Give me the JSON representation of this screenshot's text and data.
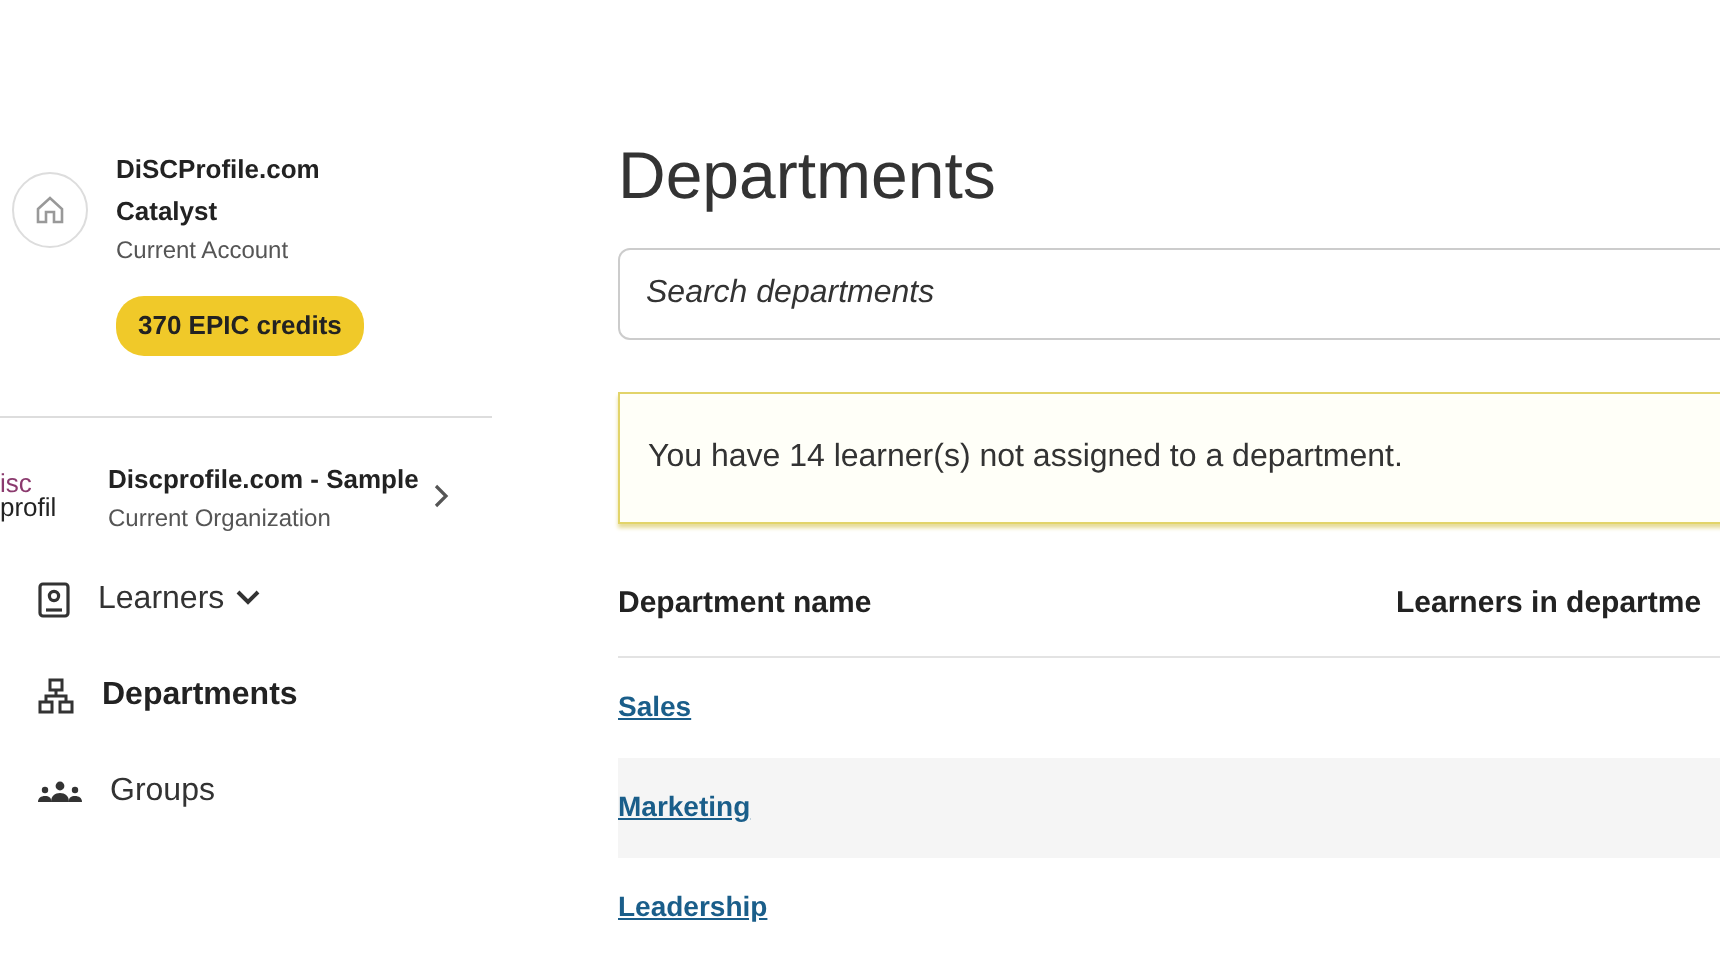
{
  "account": {
    "name": "DiSCProfile.com",
    "plan": "Catalyst",
    "caption": "Current Account",
    "credits": "370 EPIC credits"
  },
  "organization": {
    "logo_lines": [
      "isc",
      "profil"
    ],
    "name": "Discprofile.com - Sample",
    "caption": "Current Organization"
  },
  "nav": [
    {
      "kind": "learners",
      "label": "Learners",
      "selected": false,
      "has_submenu": true
    },
    {
      "kind": "departments",
      "label": "Departments",
      "selected": true,
      "has_submenu": false
    },
    {
      "kind": "groups",
      "label": "Groups",
      "selected": false,
      "has_submenu": false
    }
  ],
  "page_title": "Departments",
  "search": {
    "placeholder": "Search departments"
  },
  "notice": "You have 14 learner(s) not assigned to a department.",
  "table": {
    "columns": [
      "Department name",
      "Learners in departme"
    ],
    "rows": [
      {
        "name": "Sales"
      },
      {
        "name": "Marketing"
      },
      {
        "name": "Leadership"
      }
    ]
  }
}
